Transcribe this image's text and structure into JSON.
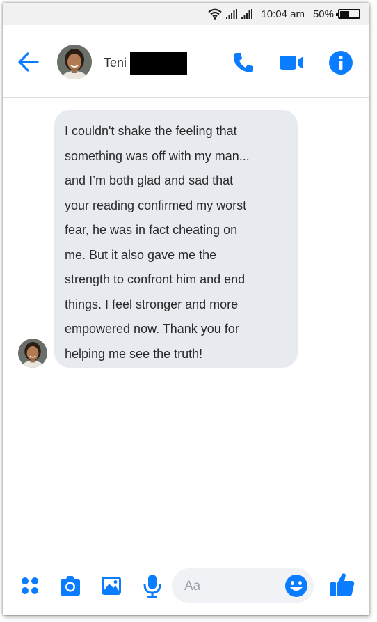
{
  "status_bar": {
    "time": "10:04 am",
    "battery": "50%",
    "battery_level": 0.5,
    "icons": [
      "wifi-icon",
      "signal-icon",
      "signal-icon",
      "battery-icon"
    ]
  },
  "header": {
    "contact_name": "Teni",
    "name_redacted": true,
    "icons": [
      "back-arrow-icon",
      "phone-icon",
      "video-camera-icon",
      "info-icon"
    ]
  },
  "conversation": {
    "message_lines": [
      "I couldn't shake the feeling that",
      "something was off with my man...",
      "and I’m both glad and sad that",
      "your reading confirmed my worst",
      "fear, he was in fact cheating on",
      "me. But it also gave me the",
      "strength to confront him and end",
      "things. I feel stronger and more",
      "empowered now. Thank you for",
      "helping me see the truth!"
    ]
  },
  "composer": {
    "placeholder": "Aa",
    "icons": [
      "apps-grid-icon",
      "camera-icon",
      "image-icon",
      "microphone-icon",
      "emoji-icon",
      "thumbs-up-icon"
    ]
  },
  "colors": {
    "accent": "#0a7cff",
    "bubble": "#e7ebf0",
    "status_bar_bg": "#f1f1f1"
  }
}
